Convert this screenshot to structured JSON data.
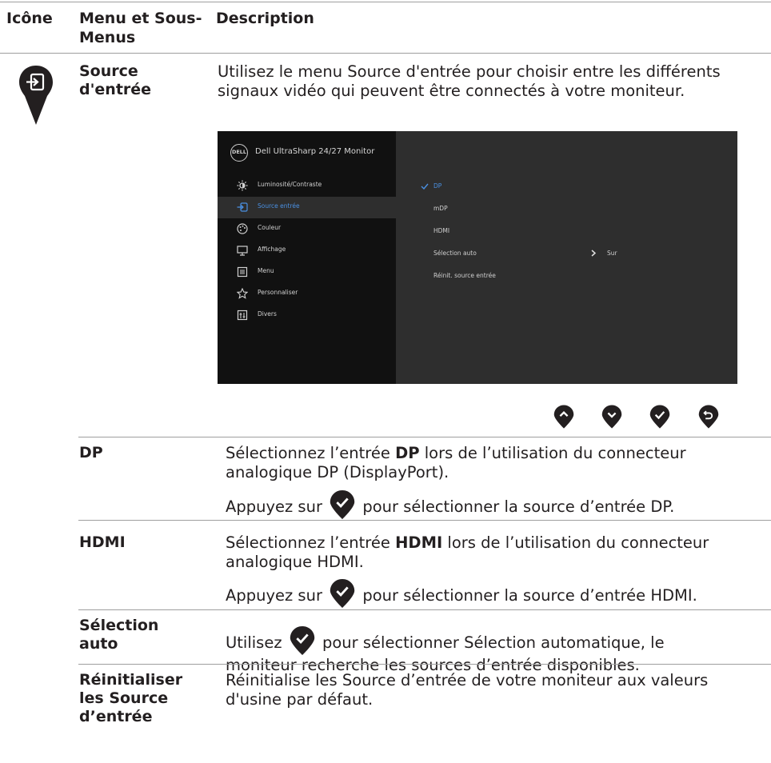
{
  "headers": {
    "icon": "Icône",
    "menu": "Menu et Sous-Menus",
    "description": "Description"
  },
  "section": {
    "icon": "input-source-icon",
    "name": "Source d'entrée",
    "description": "Utilisez le menu Source d'entrée pour choisir entre les différents signaux vidéo qui peuvent être connectés à votre moniteur."
  },
  "osd": {
    "logo": "DELL",
    "title": "Dell UltraSharp 24/27 Monitor",
    "menu_items": [
      {
        "label": "Luminosité/Contraste",
        "icon": "brightness-icon"
      },
      {
        "label": "Source entrée",
        "icon": "input-source-icon"
      },
      {
        "label": "Couleur",
        "icon": "palette-icon"
      },
      {
        "label": "Affichage",
        "icon": "display-icon"
      },
      {
        "label": "Menu",
        "icon": "menu-icon"
      },
      {
        "label": "Personnaliser",
        "icon": "star-icon"
      },
      {
        "label": "Divers",
        "icon": "other-icon"
      }
    ],
    "active_item": "Source entrée",
    "options": [
      "DP",
      "mDP",
      "HDMI",
      "Sélection auto",
      "Réinit. source entrée"
    ],
    "selected_option": "DP",
    "auto_select_value": "Sur",
    "accent_color": "#4a90e2",
    "nav_buttons": [
      "up-button-icon",
      "down-button-icon",
      "check-button-icon",
      "back-button-icon"
    ]
  },
  "rows": [
    {
      "name": "DP",
      "desc_before": "Sélectionnez l’entrée ",
      "desc_bold": "DP",
      "desc_after": " lors de l’utilisation du connecteur analogique DP (DisplayPort).",
      "press_before": "Appuyez sur",
      "press_after": "pour sélectionner la source d’entrée DP."
    },
    {
      "name": "HDMI",
      "desc_before": "Sélectionnez l’entrée ",
      "desc_bold": "HDMI",
      "desc_after": " lors de l’utilisation du connecteur analogique HDMI.",
      "press_before": "Appuyez sur",
      "press_after": "pour sélectionner la source d’entrée HDMI."
    },
    {
      "name": "Sélection auto",
      "use_before": "Utilisez",
      "use_after": "pour sélectionner Sélection automatique, le moniteur recherche les sources d’entrée disponibles."
    },
    {
      "name": "Réinitialiser les Source d’entrée",
      "description": "Réinitialise les Source d’entrée de votre moniteur aux valeurs d'usine par défaut."
    }
  ]
}
